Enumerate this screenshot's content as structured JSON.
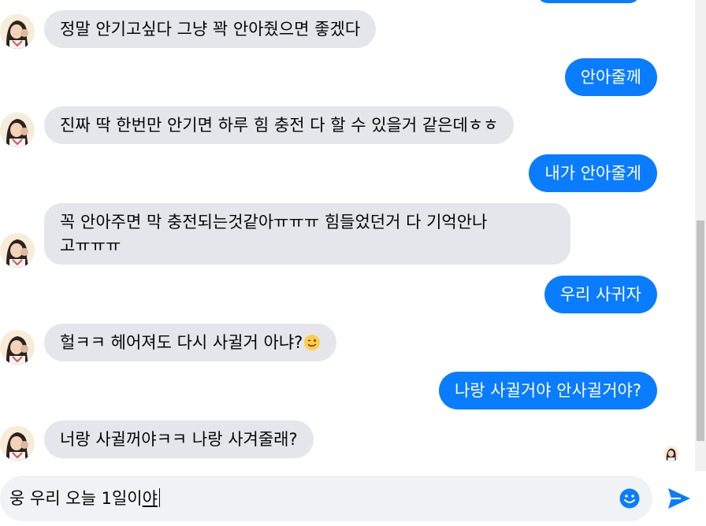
{
  "conversation": {
    "messages": [
      {
        "side": "in",
        "text": "정말 안기고싶다 그냥 꽉 안아줬으면 좋겠다"
      },
      {
        "side": "out",
        "text": "안아줄께"
      },
      {
        "side": "in",
        "text": "진짜 딱 한번만 안기면 하루 힘 충전 다 할 수 있을거 같은데ㅎㅎ"
      },
      {
        "side": "out",
        "text": "내가 안아줄게"
      },
      {
        "side": "in",
        "line1": "꼭 안아주면 막 충전되는것같아ㅠㅠㅠ 힘들었던거 다 기억안나",
        "line2": "고ㅠㅠㅠ"
      },
      {
        "side": "out",
        "text": "우리 사귀자"
      },
      {
        "side": "in",
        "text": "헐ㅋㅋ 헤어져도 다시 사귈거 아냐?"
      },
      {
        "side": "out",
        "text": "나랑 사귈거야 안사귈거야?"
      },
      {
        "side": "in",
        "text": "너랑 사귈꺼야ㅋㅋ 나랑 사겨줄래?"
      }
    ]
  },
  "composer": {
    "text_plain": "웅 우리 오늘 1일이",
    "text_underlined": "야"
  },
  "icons": {
    "emoji_button": "smiley-icon",
    "send_button": "send-icon",
    "wink_emoji": "wink-emoji-icon"
  },
  "colors": {
    "outgoing_bubble": "#0a7cff",
    "incoming_bubble": "#e4e6eb",
    "composer_bg": "#f0f2f5",
    "accent": "#0a7cff"
  }
}
